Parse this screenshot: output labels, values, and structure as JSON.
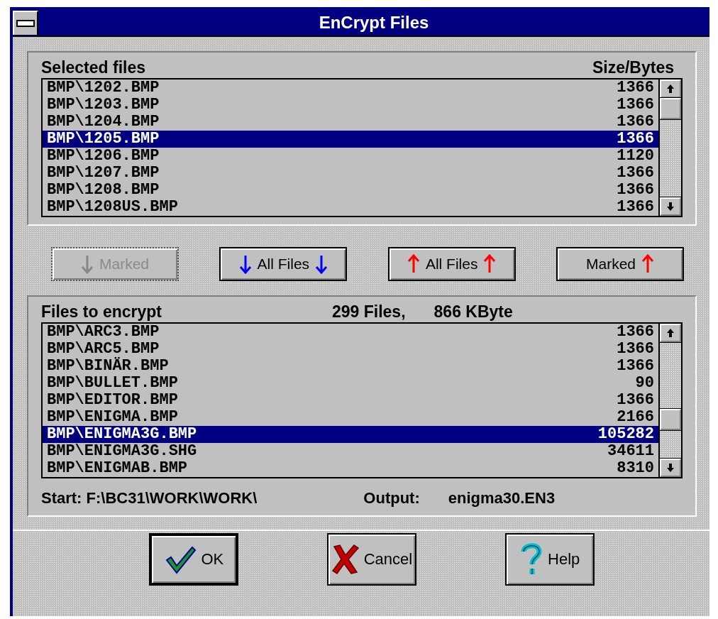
{
  "window": {
    "title": "EnCrypt Files"
  },
  "selected_files": {
    "title": "Selected files",
    "size_heading": "Size/Bytes",
    "rows": [
      {
        "name": "BMP\\1202.BMP",
        "size": "1366",
        "selected": false
      },
      {
        "name": "BMP\\1203.BMP",
        "size": "1366",
        "selected": false
      },
      {
        "name": "BMP\\1204.BMP",
        "size": "1366",
        "selected": false
      },
      {
        "name": "BMP\\1205.BMP",
        "size": "1366",
        "selected": true
      },
      {
        "name": "BMP\\1206.BMP",
        "size": "1120",
        "selected": false
      },
      {
        "name": "BMP\\1207.BMP",
        "size": "1366",
        "selected": false
      },
      {
        "name": "BMP\\1208.BMP",
        "size": "1366",
        "selected": false
      },
      {
        "name": "BMP\\1208US.BMP",
        "size": "1366",
        "selected": false
      }
    ]
  },
  "transfer_buttons": [
    {
      "label": "Marked",
      "kind": "down",
      "disabled": true
    },
    {
      "label": "All Files",
      "kind": "down",
      "disabled": false
    },
    {
      "label": "All Files",
      "kind": "up",
      "disabled": false
    },
    {
      "label": "Marked",
      "kind": "up",
      "disabled": false
    }
  ],
  "files_to_encrypt": {
    "title": "Files to encrypt",
    "count": "299 Files,",
    "total": "866 KByte",
    "rows": [
      {
        "name": "BMP\\ARC3.BMP",
        "size": "1366",
        "selected": false
      },
      {
        "name": "BMP\\ARC5.BMP",
        "size": "1366",
        "selected": false
      },
      {
        "name": "BMP\\BINÄR.BMP",
        "size": "1366",
        "selected": false
      },
      {
        "name": "BMP\\BULLET.BMP",
        "size": "90",
        "selected": false
      },
      {
        "name": "BMP\\EDITOR.BMP",
        "size": "1366",
        "selected": false
      },
      {
        "name": "BMP\\ENIGMA.BMP",
        "size": "2166",
        "selected": false
      },
      {
        "name": "BMP\\ENIGMA3G.BMP",
        "size": "105282",
        "selected": true
      },
      {
        "name": "BMP\\ENIGMA3G.SHG",
        "size": "34611",
        "selected": false
      },
      {
        "name": "BMP\\ENIGMAB.BMP",
        "size": "8310",
        "selected": false
      }
    ],
    "start": "Start: F:\\BC31\\WORK\\WORK\\",
    "output_label": "Output:",
    "output_value": "enigma30.EN3"
  },
  "dialog_buttons": [
    {
      "label": "OK",
      "kind": "ok"
    },
    {
      "label": "Cancel",
      "kind": "cancel"
    },
    {
      "label": "Help",
      "kind": "help"
    }
  ]
}
